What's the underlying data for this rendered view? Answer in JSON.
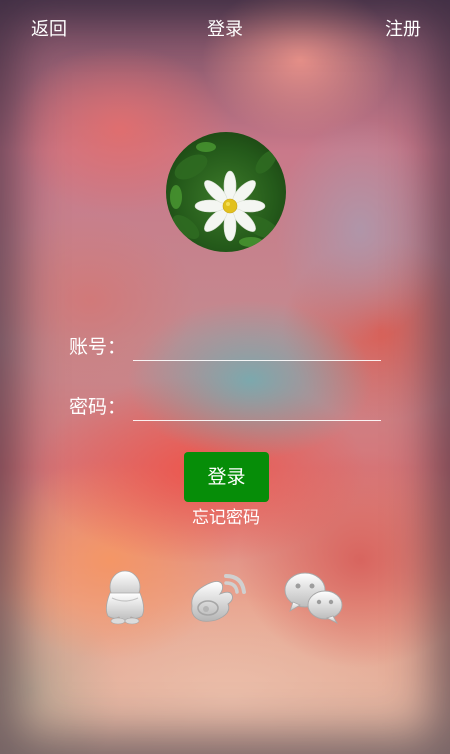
{
  "header": {
    "back_label": "返回",
    "title": "登录",
    "register_label": "注册"
  },
  "avatar": {
    "icon": "daisy-flower-photo"
  },
  "form": {
    "account_label": "账号：",
    "account_value": "",
    "password_label": "密码：",
    "password_value": ""
  },
  "actions": {
    "login_label": "登录",
    "forgot_label": "忘记密码"
  },
  "social": [
    {
      "icon": "qq-penguin-icon"
    },
    {
      "icon": "weibo-icon"
    },
    {
      "icon": "wechat-icon"
    }
  ],
  "colors": {
    "login_button": "#068d08",
    "text": "#ffffff"
  }
}
